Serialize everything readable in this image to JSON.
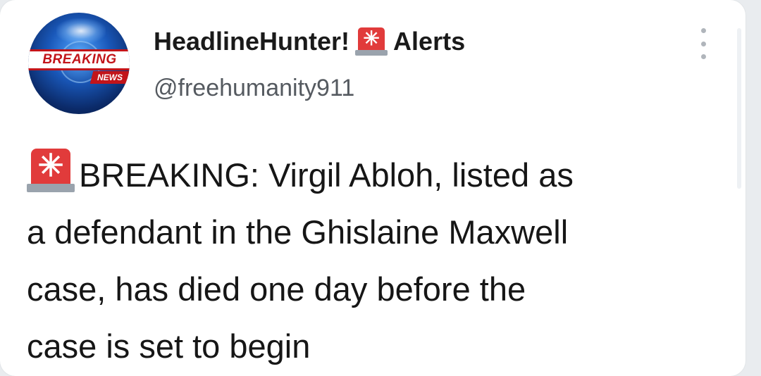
{
  "profile": {
    "avatar_text_main": "BREAKING",
    "avatar_text_sub": "NEWS",
    "display_name_part1": "HeadlineHunter!",
    "display_name_part2": "Alerts",
    "handle": "@freehumanity911",
    "emoji_icon": "police-car-light-emoji"
  },
  "tweet": {
    "line1": "BREAKING: Virgil Abloh, listed as",
    "line2": "a defendant in the Ghislaine Maxwell",
    "line3": "case, has died one day before the",
    "line4": "case is set to begin"
  },
  "colors": {
    "siren_red": "#e13b3b",
    "badge_red": "#c2141a",
    "handle_gray": "#555a60"
  }
}
